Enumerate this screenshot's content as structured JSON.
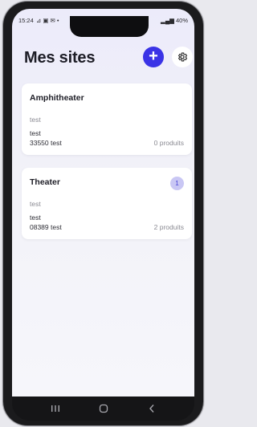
{
  "status_bar": {
    "time": "15:24",
    "left_icons": "⊿ ▣ ✉ •",
    "right_text": "40%"
  },
  "header": {
    "title": "Mes sites",
    "add_icon": "plus-icon",
    "settings_icon": "gear-icon"
  },
  "sites": [
    {
      "name": "Amphitheater",
      "subtitle": "test",
      "address_line": "test",
      "postcode_city": "33550 test",
      "products": "0 produits",
      "badge": null
    },
    {
      "name": "Theater",
      "subtitle": "test",
      "address_line": "test",
      "postcode_city": "08389 test",
      "products": "2 produits",
      "badge": "1"
    }
  ],
  "nav": {
    "recent_icon": "recent-apps-icon",
    "home_icon": "home-icon",
    "back_icon": "back-icon"
  },
  "colors": {
    "accent": "#3a33e6",
    "badge_bg": "#c9c7f4",
    "background_top": "#ecebfa"
  }
}
